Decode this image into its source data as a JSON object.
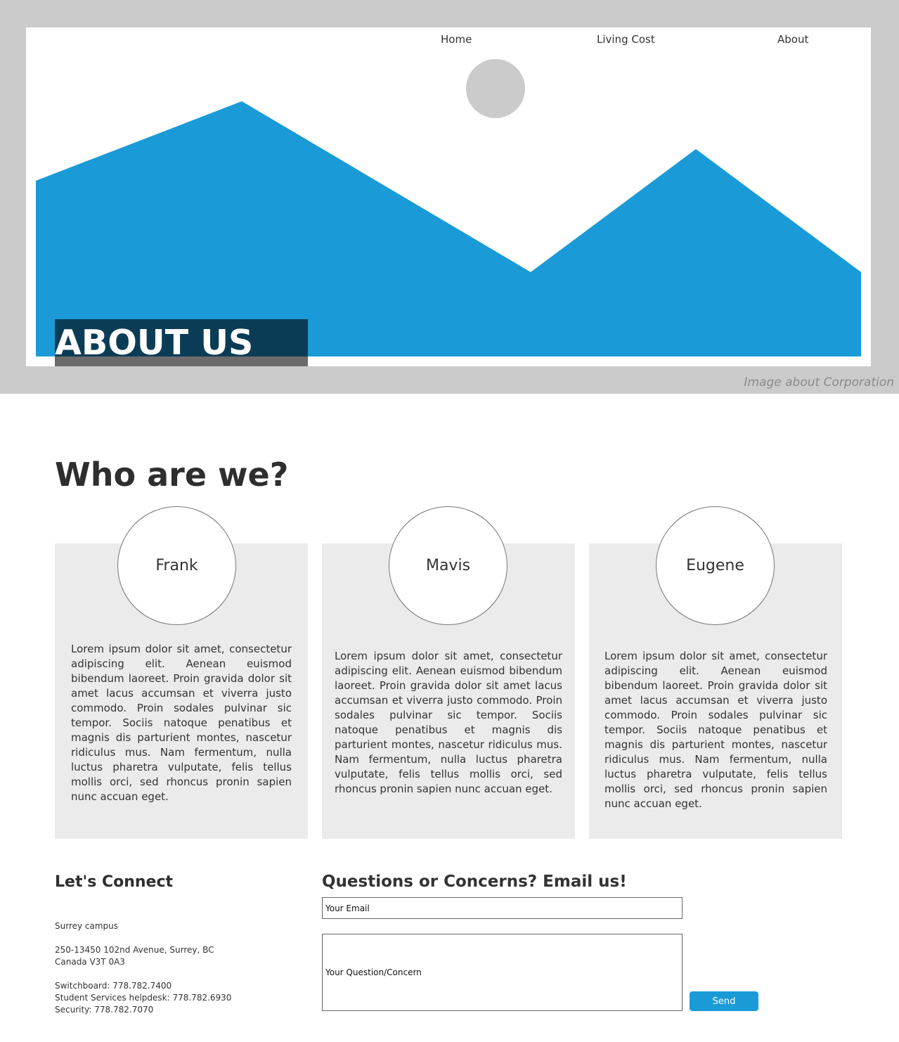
{
  "nav": {
    "items": [
      {
        "label": "Home"
      },
      {
        "label": "Living Cost"
      },
      {
        "label": "About"
      }
    ]
  },
  "hero": {
    "image_icon": "landscape-placeholder-icon",
    "caption": "Image about Corporation",
    "title": "ABOUT US",
    "colors": {
      "frame": "#cbcbcb",
      "mountain": "#1a9bd7",
      "sun": "#cbcbcb",
      "title_bg": "#0b3c55"
    }
  },
  "who": {
    "title": "Who are we?",
    "members": [
      {
        "name": "Frank",
        "bio": "Lorem ipsum dolor sit amet, consectetur adipiscing elit. Aenean euismod bibendum laoreet. Proin gravida dolor sit amet lacus accumsan et viverra justo commodo. Proin sodales pulvinar sic tempor. Sociis natoque penatibus et magnis dis parturient montes, nascetur ridiculus mus. Nam fermentum, nulla luctus pharetra vulputate, felis tellus mollis orci, sed rhoncus pronin sapien nunc accuan eget."
      },
      {
        "name": "Mavis",
        "bio": "Lorem ipsum dolor sit amet, consectetur adipiscing elit. Aenean euismod bibendum laoreet. Proin gravida dolor sit amet lacus accumsan et viverra justo commodo. Proin sodales pulvinar sic tempor. Sociis natoque penatibus et magnis dis parturient montes, nascetur ridiculus mus. Nam fermentum, nulla luctus pharetra vulputate, felis tellus mollis orci, sed rhoncus pronin sapien nunc accuan eget."
      },
      {
        "name": "Eugene",
        "bio": "Lorem ipsum dolor sit amet, consectetur adipiscing elit. Aenean euismod bibendum laoreet. Proin gravida dolor sit amet lacus accumsan et viverra justo commodo. Proin sodales pulvinar sic tempor. Sociis natoque penatibus et magnis dis parturient montes, nascetur ridiculus mus. Nam fermentum, nulla luctus pharetra vulputate, felis tellus mollis orci, sed rhoncus pronin sapien nunc accuan eget."
      }
    ]
  },
  "connect": {
    "title": "Let's Connect",
    "campus": "Surrey campus",
    "address_line1": "250-13450 102nd Avenue, Surrey, BC",
    "address_line2": "Canada V3T 0A3",
    "switchboard": "Switchboard: 778.782.7400",
    "helpdesk": "Student Services helpdesk: 778.782.6930",
    "security": "Security: 778.782.7070"
  },
  "form": {
    "title": "Questions or Concerns? Email us!",
    "email_placeholder": "Your Email",
    "question_placeholder": "Your Question/Concern",
    "send_label": "Send",
    "accent": "#1a9bd7"
  }
}
